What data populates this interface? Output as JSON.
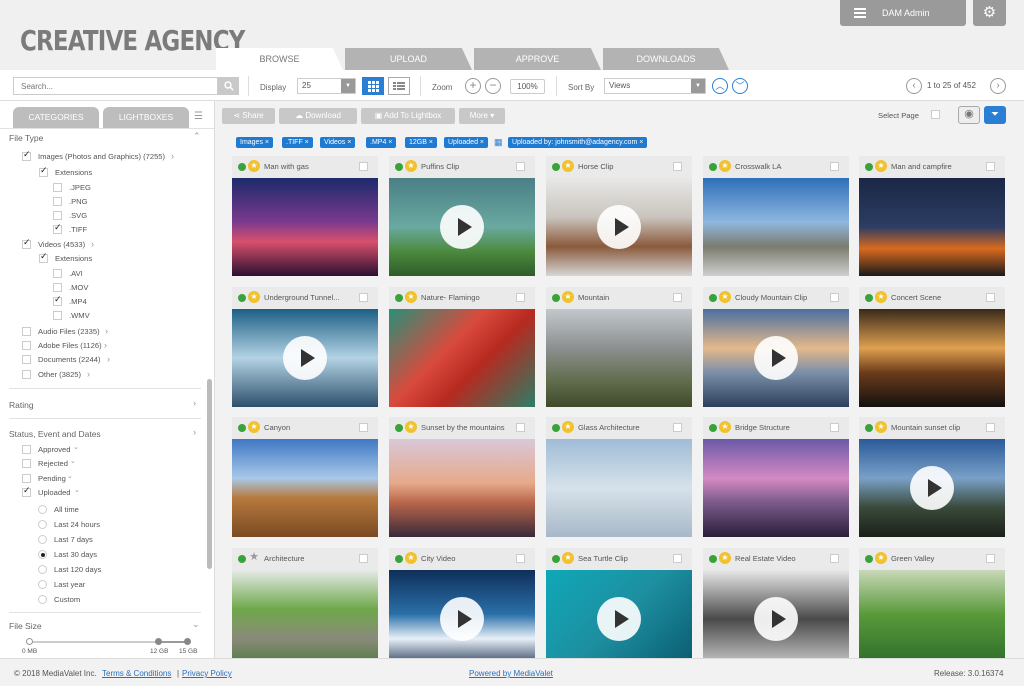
{
  "header": {
    "logo": "CREATIVE AGENCY",
    "admin_label": "DAM Admin",
    "tabs": [
      "BROWSE",
      "UPLOAD",
      "APPROVE",
      "DOWNLOADS"
    ]
  },
  "toolbar": {
    "search_placeholder": "Search...",
    "display_label": "Display",
    "display_value": "25",
    "zoom_label": "Zoom",
    "zoom_value": "100%",
    "sort_label": "Sort By",
    "sort_value": "Views",
    "pager": "1 to 25 of 452"
  },
  "sidebar": {
    "tabs": [
      "CATEGORIES",
      "LIGHTBOXES"
    ],
    "file_type": "File Type",
    "images": "Images (Photos and Graphics) (7255)",
    "extensions": "Extensions",
    "img_ext": [
      ".JPEG",
      ".PNG",
      ".SVG",
      ".TIFF"
    ],
    "videos": "Videos (4533)",
    "vid_ext": [
      ".AVI",
      ".MOV",
      ".MP4",
      ".WMV"
    ],
    "audio": "Audio Files (2335)",
    "adobe": "Adobe Files (1126)",
    "documents": "Documents (2244)",
    "other": "Other (3825)",
    "rating": "Rating",
    "status": "Status, Event and Dates",
    "approved": "Approved",
    "rejected": "Rejected",
    "pending": "Pending",
    "uploaded": "Uploaded",
    "ranges": [
      "All time",
      "Last 24 hours",
      "Last 7 days",
      "Last 30 days",
      "Last 120 days",
      "Last year",
      "Custom"
    ],
    "file_size": "File Size",
    "size_min": "0 MB",
    "size_mid": "12 GB",
    "size_max": "15 GB"
  },
  "actions": {
    "share": "Share",
    "download": "Download",
    "add_lightbox": "Add To Lightbox",
    "more": "More",
    "select_page": "Select Page"
  },
  "chips": [
    "Images",
    ".TIFF",
    "Videos",
    ".MP4",
    "12GB",
    "Uploaded",
    "Uploaded by: johnsmith@adagency.com"
  ],
  "assets": [
    {
      "title": "Man with gas",
      "video": false
    },
    {
      "title": "Puffins Clip",
      "video": true
    },
    {
      "title": "Horse Clip",
      "video": true
    },
    {
      "title": "Crosswalk LA",
      "video": false
    },
    {
      "title": "Man and campfire",
      "video": false
    },
    {
      "title": "Underground Tunnel...",
      "video": true
    },
    {
      "title": "Nature- Flamingo",
      "video": false
    },
    {
      "title": "Mountain",
      "video": false
    },
    {
      "title": "Cloudy Mountain Clip",
      "video": true
    },
    {
      "title": "Concert Scene",
      "video": false
    },
    {
      "title": "Canyon",
      "video": false
    },
    {
      "title": "Sunset by the mountains",
      "video": false
    },
    {
      "title": "Glass Architecture",
      "video": false
    },
    {
      "title": "Bridge Structure",
      "video": false
    },
    {
      "title": "Mountain sunset clip",
      "video": true
    },
    {
      "title": "Architecture",
      "video": false
    },
    {
      "title": "City Video",
      "video": true
    },
    {
      "title": "Sea Turtle Clip",
      "video": true
    },
    {
      "title": "Real Estate Video",
      "video": true
    },
    {
      "title": "Green Valley",
      "video": false
    }
  ],
  "footer": {
    "copyright": "© 2018 MediaValet Inc.",
    "terms": "Terms & Conditions",
    "divider": "|",
    "privacy": "Privacy Policy",
    "powered": "Powered by MediaValet",
    "release": "Release: 3.0.16374"
  }
}
